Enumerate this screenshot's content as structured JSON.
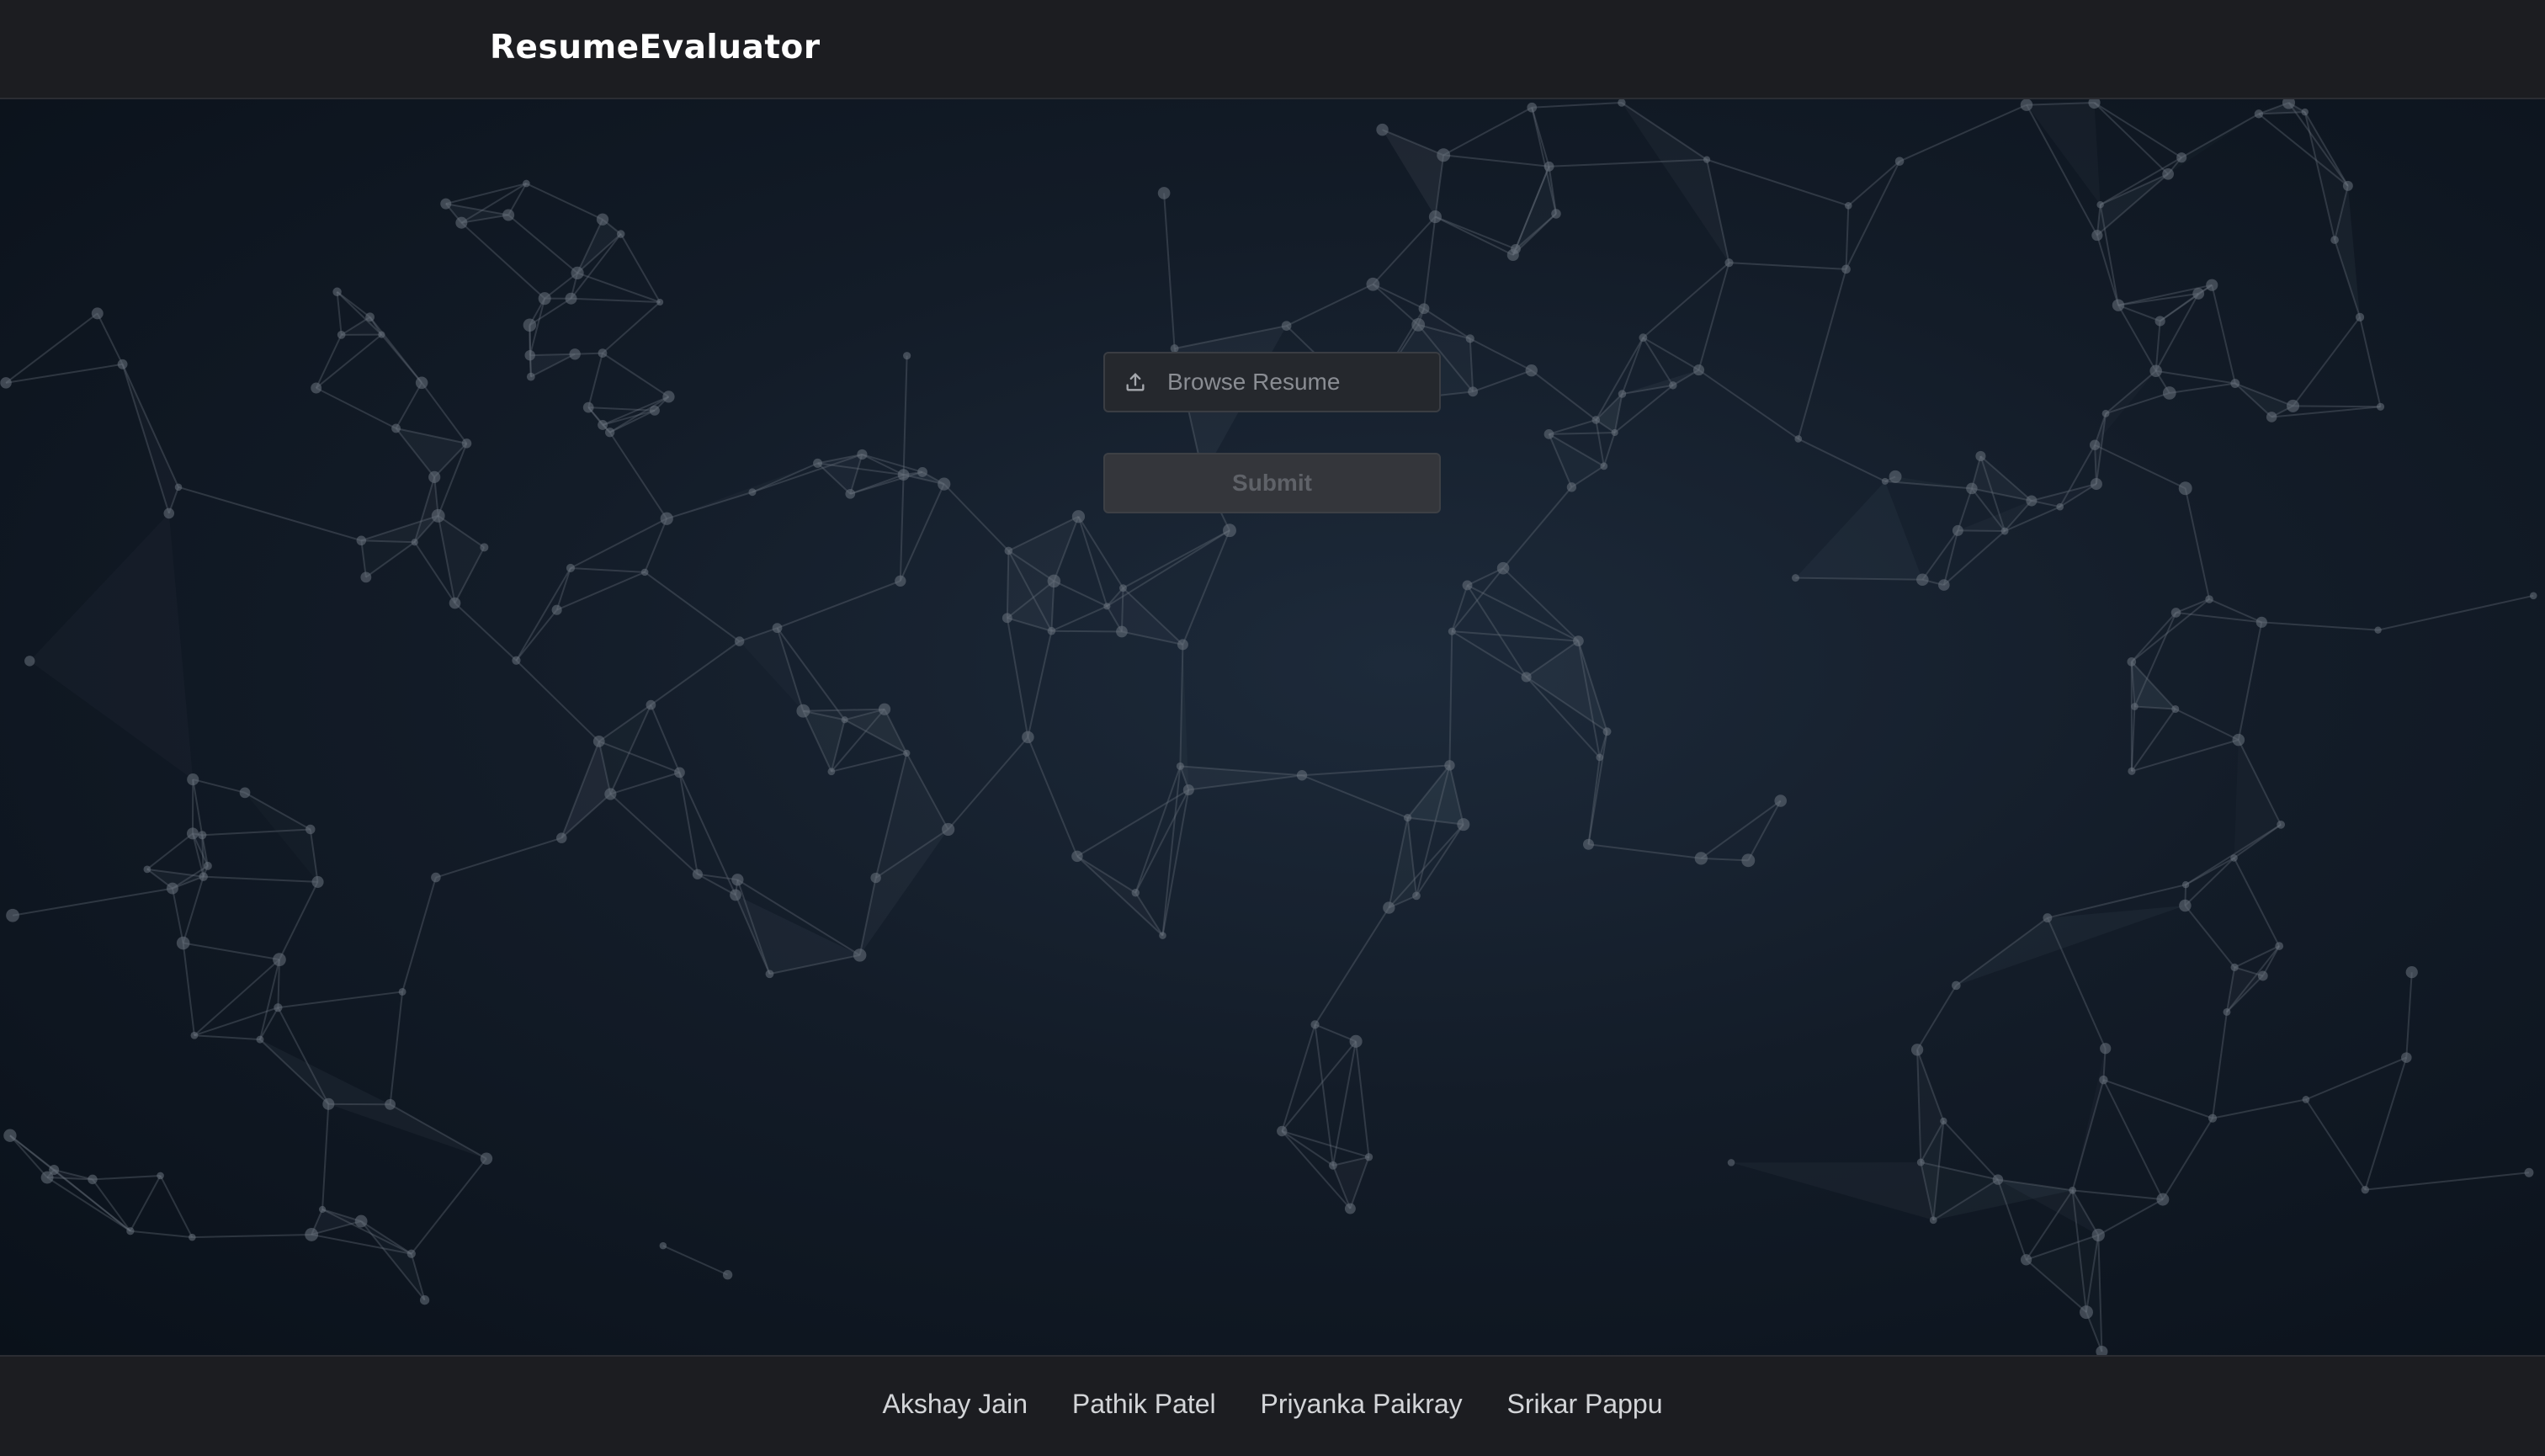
{
  "header": {
    "brand": "ResumeEvaluator"
  },
  "form": {
    "file_placeholder": "Browse Resume",
    "upload_icon": "upload-icon",
    "submit_label": "Submit"
  },
  "footer": {
    "links": [
      "Akshay Jain",
      "Pathik Patel",
      "Priyanka Paikray",
      "Srikar Pappu"
    ]
  },
  "colors": {
    "header_bg": "#1c1d21",
    "hero_bg": "#0f141b",
    "network_line": "#5a636e",
    "button_bg": "#34363b",
    "input_bg": "#25282d"
  }
}
